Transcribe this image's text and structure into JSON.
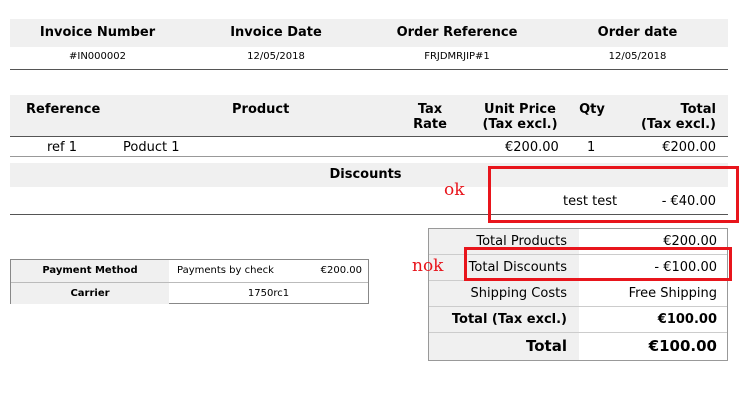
{
  "invoice_header": {
    "columns": [
      "Invoice Number",
      "Invoice Date",
      "Order Reference",
      "Order date"
    ],
    "values": [
      "#IN000002",
      "12/05/2018",
      "FRJDMRJIP#1",
      "12/05/2018"
    ]
  },
  "products": {
    "headers": {
      "reference": "Reference",
      "product": "Product",
      "tax_rate_1": "Tax",
      "tax_rate_2": "Rate",
      "unit_price_1": "Unit Price",
      "unit_price_2": "(Tax excl.)",
      "qty": "Qty",
      "total_1": "Total",
      "total_2": "(Tax excl.)"
    },
    "rows": [
      {
        "reference": "ref 1",
        "product": "Poduct 1",
        "unit_price": "€200.00",
        "qty": "1",
        "total": "€200.00"
      }
    ]
  },
  "discounts": {
    "title": "Discounts",
    "rows": [
      {
        "name": "test test",
        "amount": "- €40.00"
      }
    ]
  },
  "payment": {
    "method_label": "Payment Method",
    "method_value": "Payments by check",
    "method_amount": "€200.00",
    "carrier_label": "Carrier",
    "carrier_value": "1750rc1"
  },
  "totals": {
    "total_products_label": "Total Products",
    "total_products_value": "€200.00",
    "total_discounts_label": "Total Discounts",
    "total_discounts_value": "- €100.00",
    "shipping_label": "Shipping Costs",
    "shipping_value": "Free Shipping",
    "tax_excl_label": "Total (Tax excl.)",
    "tax_excl_value": "€100.00",
    "total_label": "Total",
    "total_value": "€100.00"
  },
  "annotations": {
    "ok": "ok",
    "nok": "nok",
    "highlight_color": "#e8151c"
  }
}
